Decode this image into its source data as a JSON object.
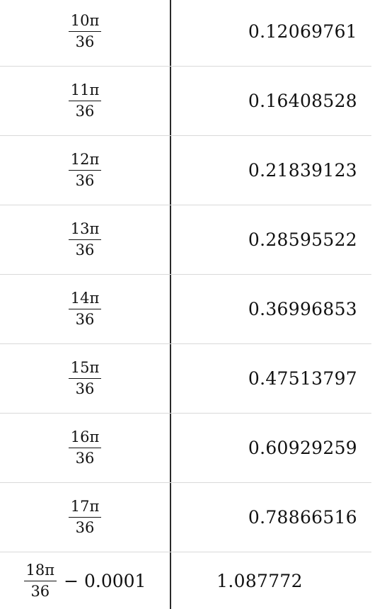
{
  "rows": [
    {
      "numerator": "10π",
      "denominator": "36",
      "suffix": "",
      "value": "0.12069761"
    },
    {
      "numerator": "11π",
      "denominator": "36",
      "suffix": "",
      "value": "0.16408528"
    },
    {
      "numerator": "12π",
      "denominator": "36",
      "suffix": "",
      "value": "0.21839123"
    },
    {
      "numerator": "13π",
      "denominator": "36",
      "suffix": "",
      "value": "0.28595522"
    },
    {
      "numerator": "14π",
      "denominator": "36",
      "suffix": "",
      "value": "0.36996853"
    },
    {
      "numerator": "15π",
      "denominator": "36",
      "suffix": "",
      "value": "0.47513797"
    },
    {
      "numerator": "16π",
      "denominator": "36",
      "suffix": "",
      "value": "0.60929259"
    },
    {
      "numerator": "17π",
      "denominator": "36",
      "suffix": "",
      "value": "0.78866516"
    },
    {
      "numerator": "18π",
      "denominator": "36",
      "suffix": "− 0.0001",
      "value": "1.087772"
    }
  ]
}
